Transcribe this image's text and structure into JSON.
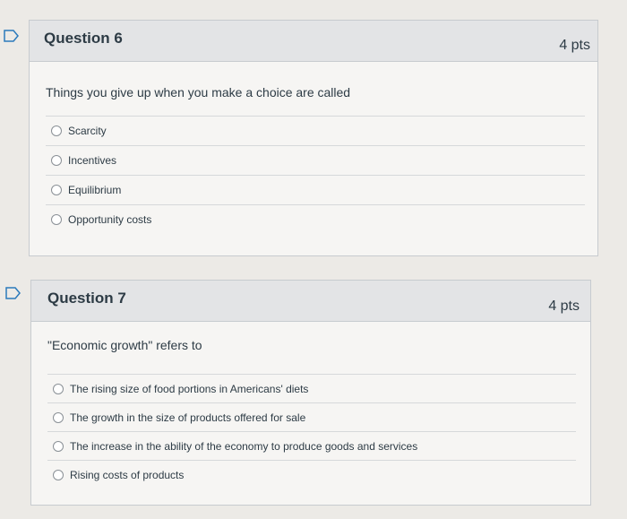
{
  "questions": [
    {
      "title": "Question 6",
      "points": "4 pts",
      "text": "Things you give up when you make a choice are called",
      "answers": [
        "Scarcity",
        "Incentives",
        "Equilibrium",
        "Opportunity costs"
      ]
    },
    {
      "title": "Question 7",
      "points": "4 pts",
      "text": "\"Economic growth\" refers to",
      "answers": [
        "The rising size of food portions in Americans' diets",
        "The growth in the size of products offered for sale",
        "The increase in the ability of the economy to produce goods and services",
        "Rising costs of products"
      ]
    }
  ],
  "icons": {
    "flag": "bookmark-flag-icon"
  }
}
